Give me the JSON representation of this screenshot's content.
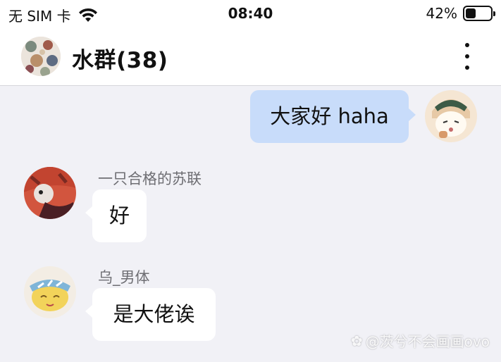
{
  "status_bar": {
    "carrier": "无 SIM 卡",
    "time": "08:40",
    "battery": "42%",
    "battery_level": 0.42
  },
  "header": {
    "title": "水群(38)"
  },
  "messages": [
    {
      "from": "me",
      "text": "大家好 haha"
    },
    {
      "from": "other",
      "sender": "一只合格的苏联",
      "text": "好"
    },
    {
      "from": "other",
      "sender": "乌_男体",
      "text": "是大佬诶"
    }
  ],
  "watermark": "@茨兮不会画画ovo",
  "colors": {
    "bubble_mine": "#c8dcfa",
    "bubble_theirs": "#ffffff",
    "background": "#f1f1f6"
  },
  "icons": {
    "signal": "wifi-icon",
    "menu": "more-vertical-icon"
  }
}
